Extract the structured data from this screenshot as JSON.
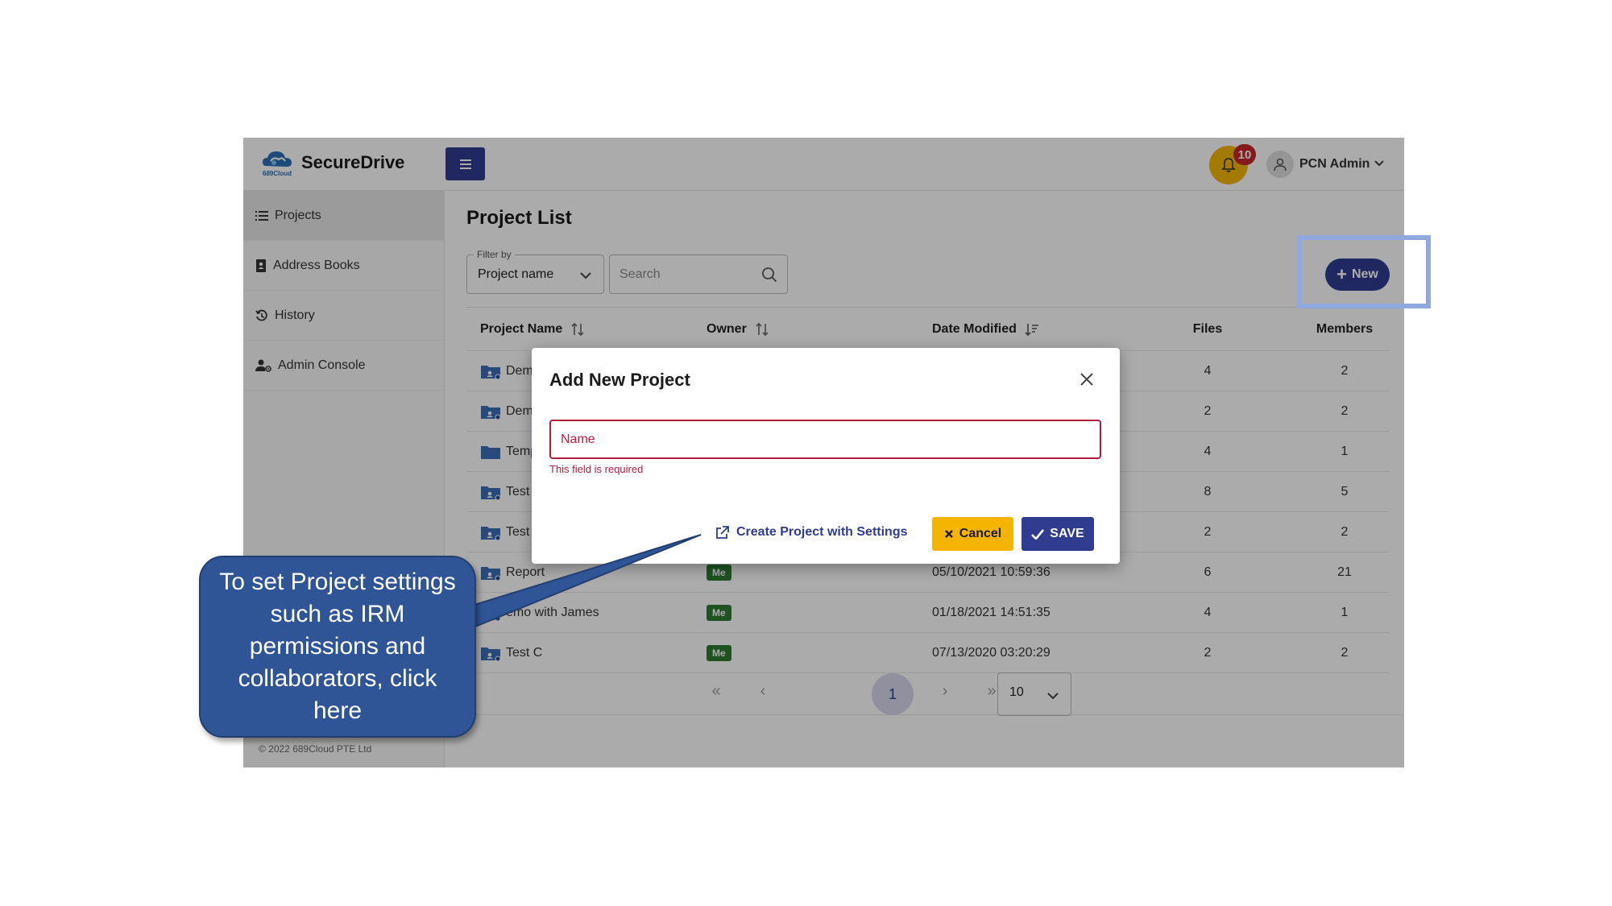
{
  "app": {
    "brand": "SecureDrive",
    "logo_caption": "689Cloud",
    "notification_count": "10",
    "user_name": "PCN Admin",
    "copyright": "© 2022 689Cloud PTE Ltd"
  },
  "sidebar": {
    "items": [
      {
        "label": "Projects",
        "icon": "list-icon",
        "active": true
      },
      {
        "label": "Address Books",
        "icon": "contact-book-icon",
        "active": false
      },
      {
        "label": "History",
        "icon": "history-icon",
        "active": false
      },
      {
        "label": "Admin Console",
        "icon": "admin-user-icon",
        "active": false
      }
    ]
  },
  "main": {
    "title": "Project List",
    "filter_legend": "Filter by",
    "filter_value": "Project name",
    "search_placeholder": "Search",
    "new_button": "New"
  },
  "table": {
    "headers": [
      "Project Name",
      "Owner",
      "Date Modified",
      "Files",
      "Members"
    ],
    "rows": [
      {
        "name": "Dem",
        "owner": "",
        "date": "",
        "files": "4",
        "members": "2",
        "shared": true
      },
      {
        "name": "Dem",
        "owner": "",
        "date": "",
        "files": "2",
        "members": "2",
        "shared": true
      },
      {
        "name": "Temp",
        "owner": "",
        "date": "",
        "files": "4",
        "members": "1",
        "shared": false
      },
      {
        "name": "Test",
        "owner": "",
        "date": "",
        "files": "8",
        "members": "5",
        "shared": true
      },
      {
        "name": "Test",
        "owner": "",
        "date": "",
        "files": "2",
        "members": "2",
        "shared": true
      },
      {
        "name": "Report",
        "owner": "Me",
        "date": "05/10/2021 10:59:36",
        "files": "6",
        "members": "21",
        "shared": true
      },
      {
        "name": "emo with James",
        "owner": "Me",
        "date": "01/18/2021 14:51:35",
        "files": "4",
        "members": "1",
        "shared": true
      },
      {
        "name": "Test C",
        "owner": "Me",
        "date": "07/13/2020 03:20:29",
        "files": "2",
        "members": "2",
        "shared": true
      }
    ]
  },
  "pagination": {
    "first": "«",
    "prev": "‹",
    "current_page": "1",
    "next": "›",
    "last": "»",
    "per_page": "10"
  },
  "modal": {
    "title": "Add New Project",
    "name_placeholder": "Name",
    "error_text": "This field is required",
    "settings_link": "Create Project with Settings",
    "cancel_label": "Cancel",
    "save_label": "SAVE"
  },
  "callout": {
    "text": "To set Project settings such as IRM permissions and collaborators, click here"
  },
  "colors": {
    "primary": "#2f3c8f",
    "accent_yellow": "#f5b400",
    "error": "#b71c3c",
    "badge_green": "#2e7d32",
    "callout_blue": "#2f5597",
    "highlight": "#8fa8e0"
  }
}
